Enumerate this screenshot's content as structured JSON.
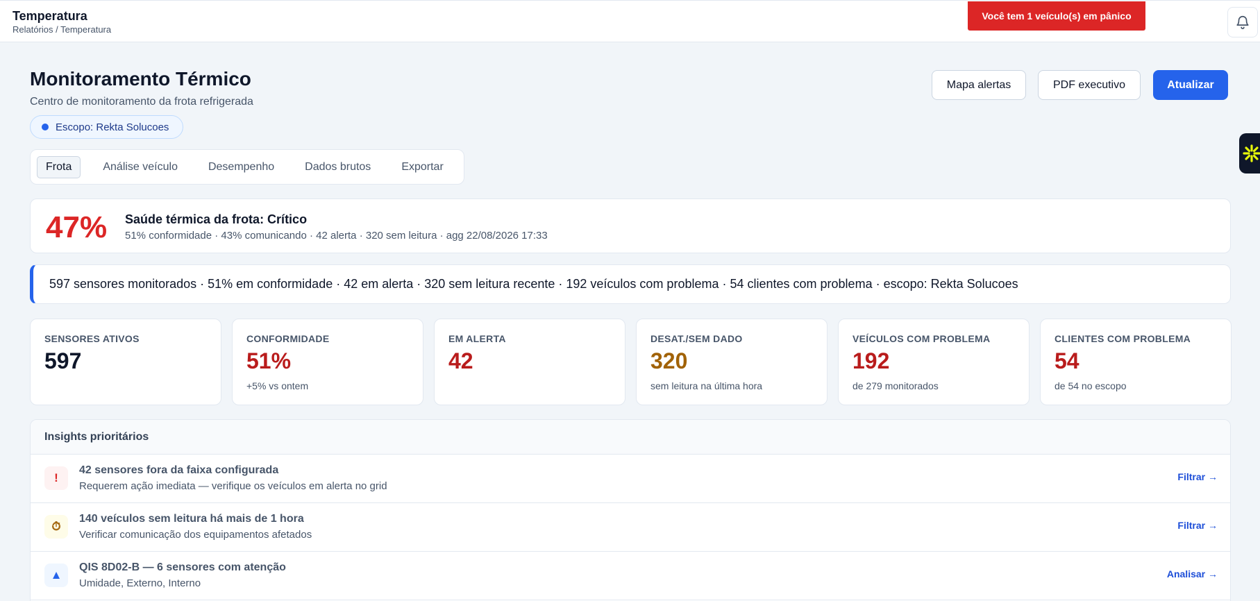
{
  "header": {
    "title": "Temperatura",
    "breadcrumb": "Relatórios / Temperatura",
    "panic_text": "Você tem 1 veículo(s) em pânico",
    "bell_icon": "bell-icon"
  },
  "page": {
    "title": "Monitoramento Térmico",
    "subtitle": "Centro de monitoramento da frota refrigerada",
    "scope": "Escopo: Rekta Solucoes"
  },
  "actions": {
    "map_alerts": "Mapa alertas",
    "pdf": "PDF executivo",
    "refresh": "Atualizar"
  },
  "tabs": [
    {
      "label": "Frota",
      "active": true
    },
    {
      "label": "Análise veículo",
      "active": false
    },
    {
      "label": "Desempenho",
      "active": false
    },
    {
      "label": "Dados brutos",
      "active": false
    },
    {
      "label": "Exportar",
      "active": false
    }
  ],
  "health": {
    "percent": "47%",
    "title": "Saúde térmica da frota: Crítico",
    "details": "51% conformidade · 43% comunicando · 42 alerta · 320 sem leitura · agg 22/08/2026 17:33"
  },
  "summary": "597 sensores monitorados · 51% em conformidade · 42 em alerta · 320 sem leitura recente · 192 veículos com problema · 54 clientes com problema · escopo: Rekta Solucoes",
  "kpis": [
    {
      "label": "SENSORES ATIVOS",
      "value": "597",
      "sub": "",
      "color": "#0f172a"
    },
    {
      "label": "CONFORMIDADE",
      "value": "51%",
      "sub": "+5% vs ontem",
      "color": "#b91c1c"
    },
    {
      "label": "EM ALERTA",
      "value": "42",
      "sub": "",
      "color": "#b91c1c"
    },
    {
      "label": "DESAT./SEM DADO",
      "value": "320",
      "sub": "sem leitura na última hora",
      "color": "#a16207"
    },
    {
      "label": "VEÍCULOS COM PROBLEMA",
      "value": "192",
      "sub": "de 279 monitorados",
      "color": "#b91c1c"
    },
    {
      "label": "CLIENTES COM PROBLEMA",
      "value": "54",
      "sub": "de 54 no escopo",
      "color": "#b91c1c"
    }
  ],
  "insights": {
    "title": "Insights prioritários",
    "items": [
      {
        "icon": "exclamation-icon",
        "glyph": "!",
        "bg": "#fef2f2",
        "fg": "#dc2626",
        "title": "42 sensores fora da faixa configurada",
        "desc": "Requerem ação imediata — verifique os veículos em alerta no grid",
        "action": "Filtrar →"
      },
      {
        "icon": "stopwatch-icon",
        "glyph": "⏱",
        "bg": "#fefce8",
        "fg": "#a16207",
        "title": "140 veículos sem leitura há mais de 1 hora",
        "desc": "Verificar comunicação dos equipamentos afetados",
        "action": "Filtrar →"
      },
      {
        "icon": "triangle-up-icon",
        "glyph": "▲",
        "bg": "#eff6ff",
        "fg": "#2563eb",
        "title": "QIS 8D02-B — 6 sensores com atenção",
        "desc": "Umidade, Externo, Interno",
        "action": "Analisar →"
      }
    ]
  },
  "widget_icon": "sparkle-icon"
}
